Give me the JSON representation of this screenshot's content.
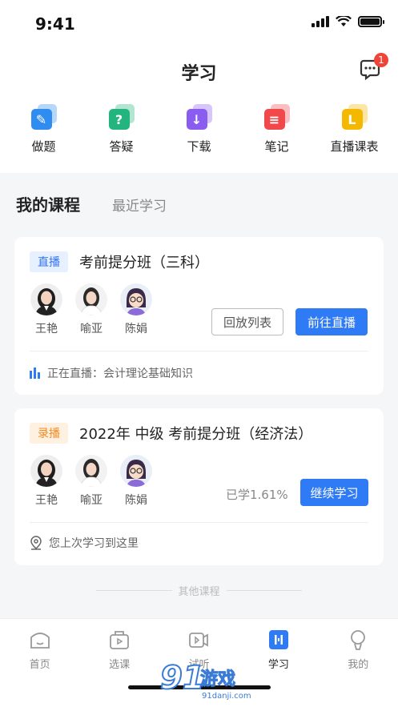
{
  "status_bar": {
    "time": "9:41"
  },
  "header": {
    "title": "学习",
    "message_badge": "1"
  },
  "quick_actions": [
    {
      "label": "做题",
      "icon": "pencil-icon",
      "color": "#2f8cf0"
    },
    {
      "label": "答疑",
      "icon": "question-icon",
      "color": "#23b57d"
    },
    {
      "label": "下载",
      "icon": "download-icon",
      "color": "#8a5cf0"
    },
    {
      "label": "笔记",
      "icon": "note-icon",
      "color": "#f0484b"
    },
    {
      "label": "直播课表",
      "icon": "schedule-icon",
      "color": "#f5b800"
    }
  ],
  "tabs": {
    "active": "我的课程",
    "inactive": "最近学习"
  },
  "courses": [
    {
      "tag": "直播",
      "title": "考前提分班（三科）",
      "teachers": [
        "王艳",
        "喻亚",
        "陈娟"
      ],
      "secondary_button": "回放列表",
      "primary_button": "前往直播",
      "status_text": "正在直播：会计理论基础知识"
    },
    {
      "tag": "录播",
      "title": "2022年 中级 考前提分班（经济法）",
      "teachers": [
        "王艳",
        "喻亚",
        "陈娟"
      ],
      "progress_text": "已学1.61%",
      "primary_button": "继续学习",
      "status_text": "您上次学习到这里"
    }
  ],
  "other_courses_label": "其他课程",
  "tabbar": [
    {
      "label": "首页",
      "icon": "home-icon",
      "active": false
    },
    {
      "label": "选课",
      "icon": "course-select-icon",
      "active": false
    },
    {
      "label": "试听",
      "icon": "trial-video-icon",
      "active": false
    },
    {
      "label": "学习",
      "icon": "study-icon",
      "active": true
    },
    {
      "label": "我的",
      "icon": "profile-icon",
      "active": false
    }
  ],
  "watermark": {
    "brand": "91",
    "text": "游戏",
    "url": "91danji.com"
  },
  "colors": {
    "primary": "#2f7af5",
    "live_tag": "#3173f4",
    "recorded_tag": "#f08a1e",
    "badge": "#f04438"
  }
}
